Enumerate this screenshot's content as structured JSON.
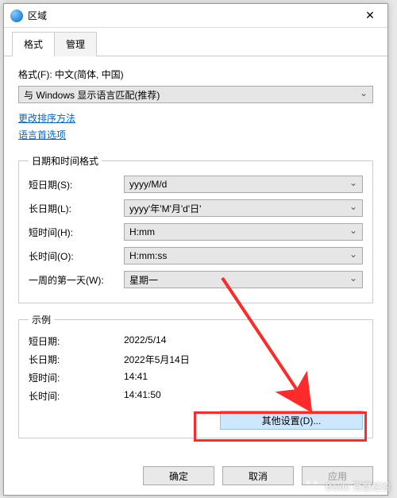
{
  "window": {
    "title": "区域",
    "close": "✕"
  },
  "tabs": {
    "format": "格式",
    "admin": "管理"
  },
  "format": {
    "label": "格式(F): 中文(简体, 中国)",
    "language_select": "与 Windows 显示语言匹配(推荐)",
    "link_sort": "更改排序方法",
    "link_lang": "语言首选项"
  },
  "datetime": {
    "legend": "日期和时间格式",
    "short_date_label": "短日期(S):",
    "short_date_value": "yyyy/M/d",
    "long_date_label": "长日期(L):",
    "long_date_value": "yyyy'年'M'月'd'日'",
    "short_time_label": "短时间(H):",
    "short_time_value": "H:mm",
    "long_time_label": "长时间(O):",
    "long_time_value": "H:mm:ss",
    "first_day_label": "一周的第一天(W):",
    "first_day_value": "星期一"
  },
  "example": {
    "legend": "示例",
    "short_date_label": "短日期:",
    "short_date_value": "2022/5/14",
    "long_date_label": "长日期:",
    "long_date_value": "2022年5月14日",
    "short_time_label": "短时间:",
    "short_time_value": "14:41",
    "long_time_label": "长时间:",
    "long_time_value": "14:41:50"
  },
  "buttons": {
    "additional": "其他设置(D)...",
    "ok": "确定",
    "cancel": "取消",
    "apply": "应用"
  },
  "watermark": "Baidu 百度经验",
  "annotations": {
    "arrow_color": "#ff2a2a",
    "highlight_color": "#ff2a2a"
  }
}
